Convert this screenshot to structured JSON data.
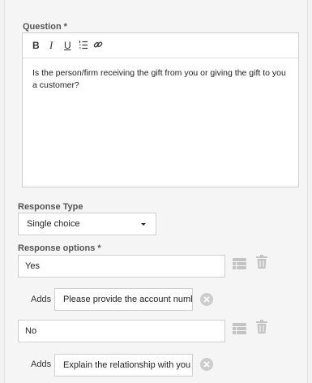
{
  "question": {
    "label": "Question",
    "required_mark": "*",
    "toolbar": {
      "bold": "B",
      "italic": "I",
      "underline": "U"
    },
    "text": "Is the person/firm receiving the gift from you or giving the gift to you a customer?"
  },
  "response_type": {
    "label": "Response Type",
    "selected": "Single choice"
  },
  "response_options": {
    "label": "Response options",
    "required_mark": "*",
    "options": [
      {
        "value": "Yes",
        "adds_label": "Adds",
        "adds_value": "Please provide the account number"
      },
      {
        "value": "No",
        "adds_label": "Adds",
        "adds_value": "Explain the relationship with you"
      }
    ]
  },
  "colors": {
    "icon_gray": "#c4c4c4",
    "border": "#cfcfcf"
  }
}
